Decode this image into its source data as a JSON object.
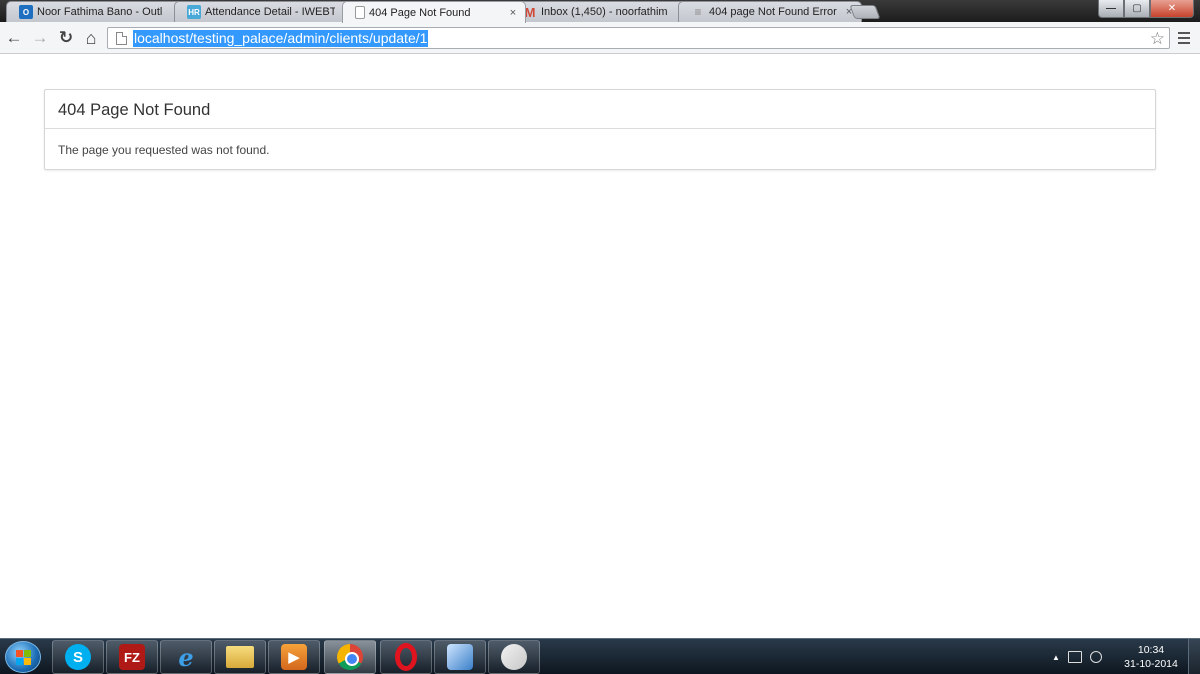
{
  "browser": {
    "tabs": [
      {
        "title": "Noor Fathima Bano - Outl",
        "favicon": "outlook-icon",
        "favicon_text": "O",
        "active": false
      },
      {
        "title": "Attendance Detail - IWEBT",
        "favicon": "hr-icon",
        "favicon_text": "HR",
        "active": false
      },
      {
        "title": "404 Page Not Found",
        "favicon": "page-icon",
        "favicon_text": "",
        "active": true
      },
      {
        "title": "Inbox (1,450) - noorfathim",
        "favicon": "gmail-icon",
        "favicon_text": "M",
        "active": false
      },
      {
        "title": "404 page Not Found Error",
        "favicon": "stackoverflow-icon",
        "favicon_text": "≡",
        "active": false
      }
    ],
    "close_glyph": "×",
    "back_glyph": "←",
    "forward_glyph": "→",
    "reload_glyph": "↻",
    "home_glyph": "⌂",
    "star_glyph": "☆",
    "url": "localhost/testing_palace/admin/clients/update/1",
    "window_buttons": {
      "minimize": "—",
      "maximize": "▢",
      "close": "✕"
    }
  },
  "page": {
    "heading": "404 Page Not Found",
    "message": "The page you requested was not found."
  },
  "taskbar": {
    "apps": [
      {
        "name": "skype",
        "glyph": "S",
        "active": false
      },
      {
        "name": "filezilla",
        "glyph": "FZ",
        "active": false
      },
      {
        "name": "internet-explorer",
        "glyph": "e",
        "active": false
      },
      {
        "name": "file-explorer",
        "glyph": "",
        "active": false
      },
      {
        "name": "media-player",
        "glyph": "▶",
        "active": false
      },
      {
        "name": "chrome",
        "glyph": "",
        "active": true
      },
      {
        "name": "opera",
        "glyph": "",
        "active": false
      },
      {
        "name": "virtualbox",
        "glyph": "",
        "active": false
      },
      {
        "name": "paint",
        "glyph": "",
        "active": false
      }
    ],
    "tray_arrow": "▲",
    "time": "10:34",
    "date": "31-10-2014"
  },
  "colors": {
    "url_selection": "#3399ff",
    "windows_logo": [
      "#f35325",
      "#81bc06",
      "#05a6f0",
      "#ffba08"
    ]
  }
}
